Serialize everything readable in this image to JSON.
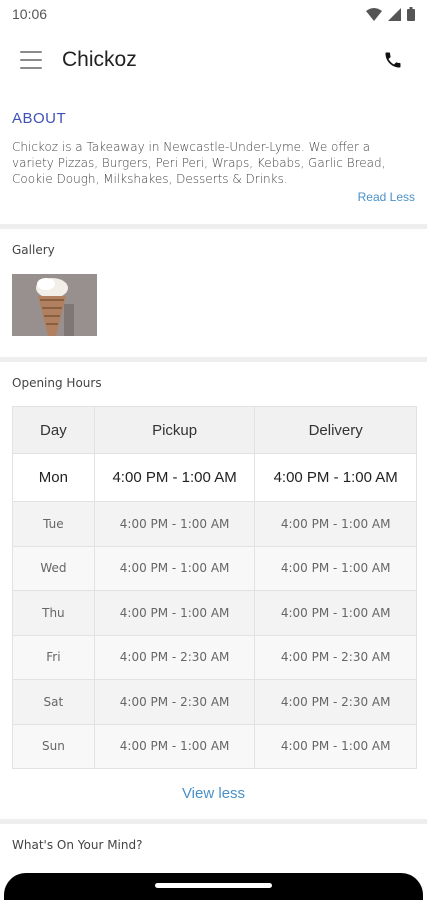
{
  "status_bar": {
    "time": "10:06"
  },
  "app_bar": {
    "title": "Chickoz"
  },
  "about": {
    "title": "ABOUT",
    "text": "Chickoz is a Takeaway in Newcastle-Under-Lyme. We offer a variety Pizzas, Burgers, Peri Peri, Wraps, Kebabs, Garlic Bread, Cookie Dough, Milkshakes, Desserts & Drinks.",
    "read_less_label": "Read Less"
  },
  "gallery": {
    "label": "Gallery"
  },
  "opening_hours": {
    "label": "Opening Hours",
    "headers": {
      "day": "Day",
      "pickup": "Pickup",
      "delivery": "Delivery"
    },
    "rows": [
      {
        "day": "Mon",
        "pickup": "4:00 PM - 1:00 AM",
        "delivery": "4:00 PM - 1:00 AM"
      },
      {
        "day": "Tue",
        "pickup": "4:00 PM - 1:00 AM",
        "delivery": "4:00 PM - 1:00 AM"
      },
      {
        "day": "Wed",
        "pickup": "4:00 PM - 1:00 AM",
        "delivery": "4:00 PM - 1:00 AM"
      },
      {
        "day": "Thu",
        "pickup": "4:00 PM - 1:00 AM",
        "delivery": "4:00 PM - 1:00 AM"
      },
      {
        "day": "Fri",
        "pickup": "4:00 PM - 2:30 AM",
        "delivery": "4:00 PM - 2:30 AM"
      },
      {
        "day": "Sat",
        "pickup": "4:00 PM - 2:30 AM",
        "delivery": "4:00 PM - 2:30 AM"
      },
      {
        "day": "Sun",
        "pickup": "4:00 PM - 1:00 AM",
        "delivery": "4:00 PM - 1:00 AM"
      }
    ],
    "view_less_label": "View less"
  },
  "whats_on_your_mind": {
    "label": "What's On Your Mind?"
  },
  "icons": {
    "menu": "hamburger-menu-icon",
    "phone": "phone-icon",
    "wifi": "wifi-icon",
    "signal": "signal-icon",
    "battery": "battery-icon"
  },
  "colors": {
    "accent": "#3f51b5",
    "link": "#4a90c8"
  }
}
